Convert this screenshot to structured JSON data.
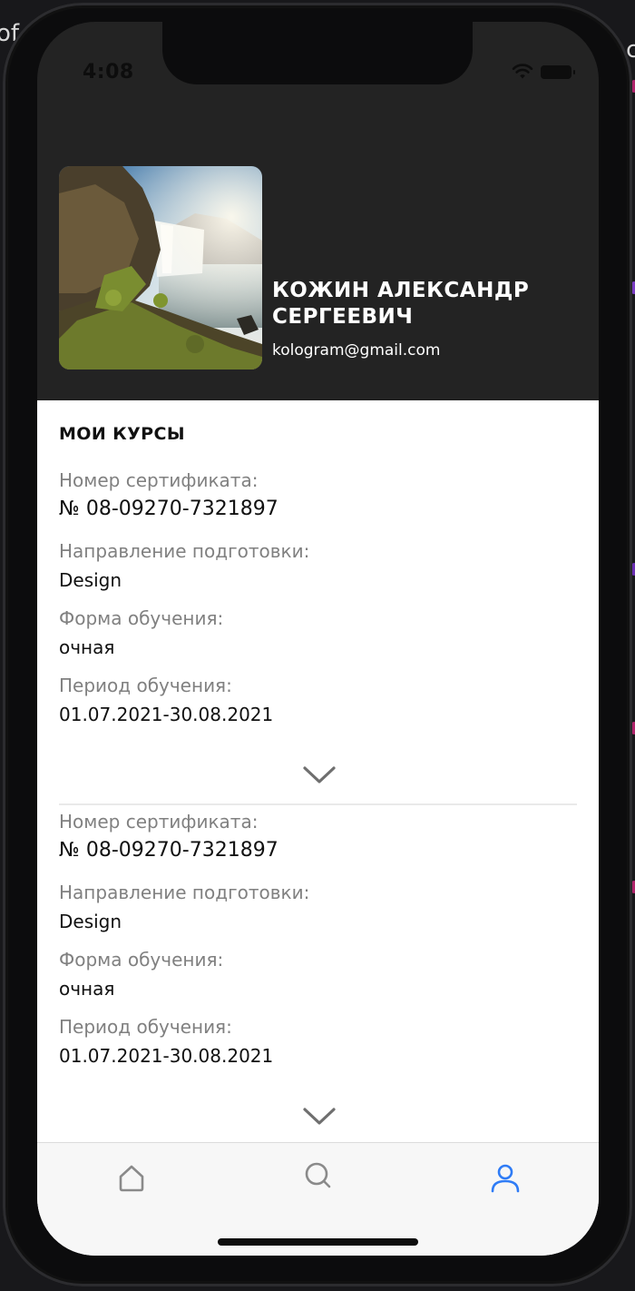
{
  "background": {
    "left_text": "of",
    "right_text": "c"
  },
  "status_bar": {
    "time": "4:08"
  },
  "profile": {
    "name": "КОЖИН АЛЕКСАНДР СЕРГЕЕВИЧ",
    "email": "kologram@gmail.com",
    "avatar": "waterfall-landscape-photo"
  },
  "courses_section": {
    "title": "МОИ КУРСЫ",
    "courses": [
      {
        "certificate_label": "Номер сертификата:",
        "certificate_value": "№ 08-09270-7321897",
        "direction_label": "Направление подготовки:",
        "direction_value": "Design",
        "form_label": "Форма обучения:",
        "form_value": "очная",
        "period_label": "Период обучения:",
        "period_value": "01.07.2021-30.08.2021"
      },
      {
        "certificate_label": "Номер сертификата:",
        "certificate_value": "№ 08-09270-7321897",
        "direction_label": "Направление подготовки:",
        "direction_value": "Design",
        "form_label": "Форма обучения:",
        "form_value": "очная",
        "period_label": "Период обучения:",
        "period_value": "01.07.2021-30.08.2021"
      }
    ]
  },
  "tab_bar": {
    "tabs": [
      {
        "icon": "home-icon",
        "active": false
      },
      {
        "icon": "search-icon",
        "active": false
      },
      {
        "icon": "profile-icon",
        "active": true
      }
    ]
  },
  "colors": {
    "header_bg": "#232323",
    "accent": "#2f7cf6",
    "label_gray": "#808080",
    "tab_inactive": "#8a8a8a"
  }
}
